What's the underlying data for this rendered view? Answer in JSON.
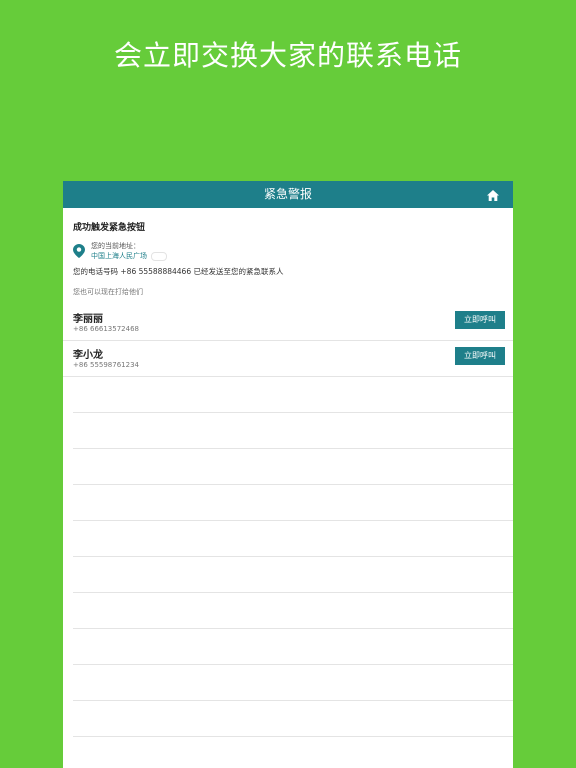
{
  "headline": "会立即交换大家的联系电话",
  "navbar": {
    "title": "紧急警报",
    "home_icon": "home-icon"
  },
  "alert": {
    "success_text": "成功触发紧急按钮",
    "address_label": "您的当前地址：",
    "address_value": "中国上海人民广场",
    "phone_notice": "您的电话号码 +86 55588884466 已经发送至您的紧急联系人",
    "call_hint": "您也可以现在打给他们"
  },
  "contacts": [
    {
      "name": "李丽丽",
      "phone": "+86 66613572468",
      "call_label": "立即呼叫"
    },
    {
      "name": "李小龙",
      "phone": "+86 55598761234",
      "call_label": "立即呼叫"
    }
  ],
  "colors": {
    "background": "#66cc3a",
    "accent": "#1e7f8a"
  }
}
